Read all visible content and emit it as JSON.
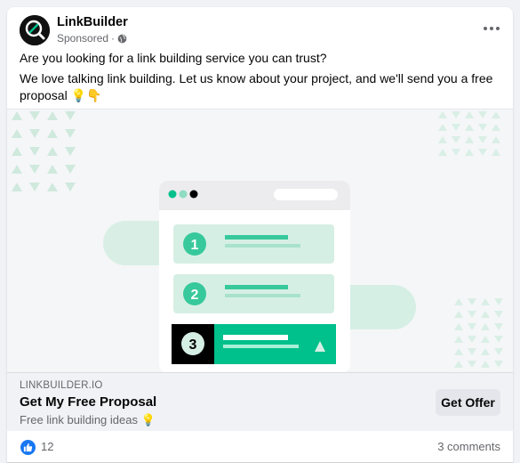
{
  "post": {
    "page_name": "LinkBuilder",
    "sponsored_label": "Sponsored",
    "separator": "·",
    "icon_more": "more-options-icon",
    "text_line1": "Are you looking for a link building service you can trust?",
    "text_line2": "We love talking link building. Let us know about your project, and we'll send you a free proposal 💡👇"
  },
  "creative": {
    "steps": [
      "1",
      "2",
      "3"
    ],
    "colors": {
      "accent": "#00c08b",
      "accent_light": "#d6efe5",
      "dark": "#000000",
      "background": "#f5f6f8"
    }
  },
  "link": {
    "domain": "LINKBUILDER.IO",
    "headline": "Get My Free Proposal",
    "description": "Free link building ideas 💡",
    "cta_label": "Get Offer"
  },
  "engagement": {
    "like_count": "12",
    "comments": "3 comments"
  }
}
